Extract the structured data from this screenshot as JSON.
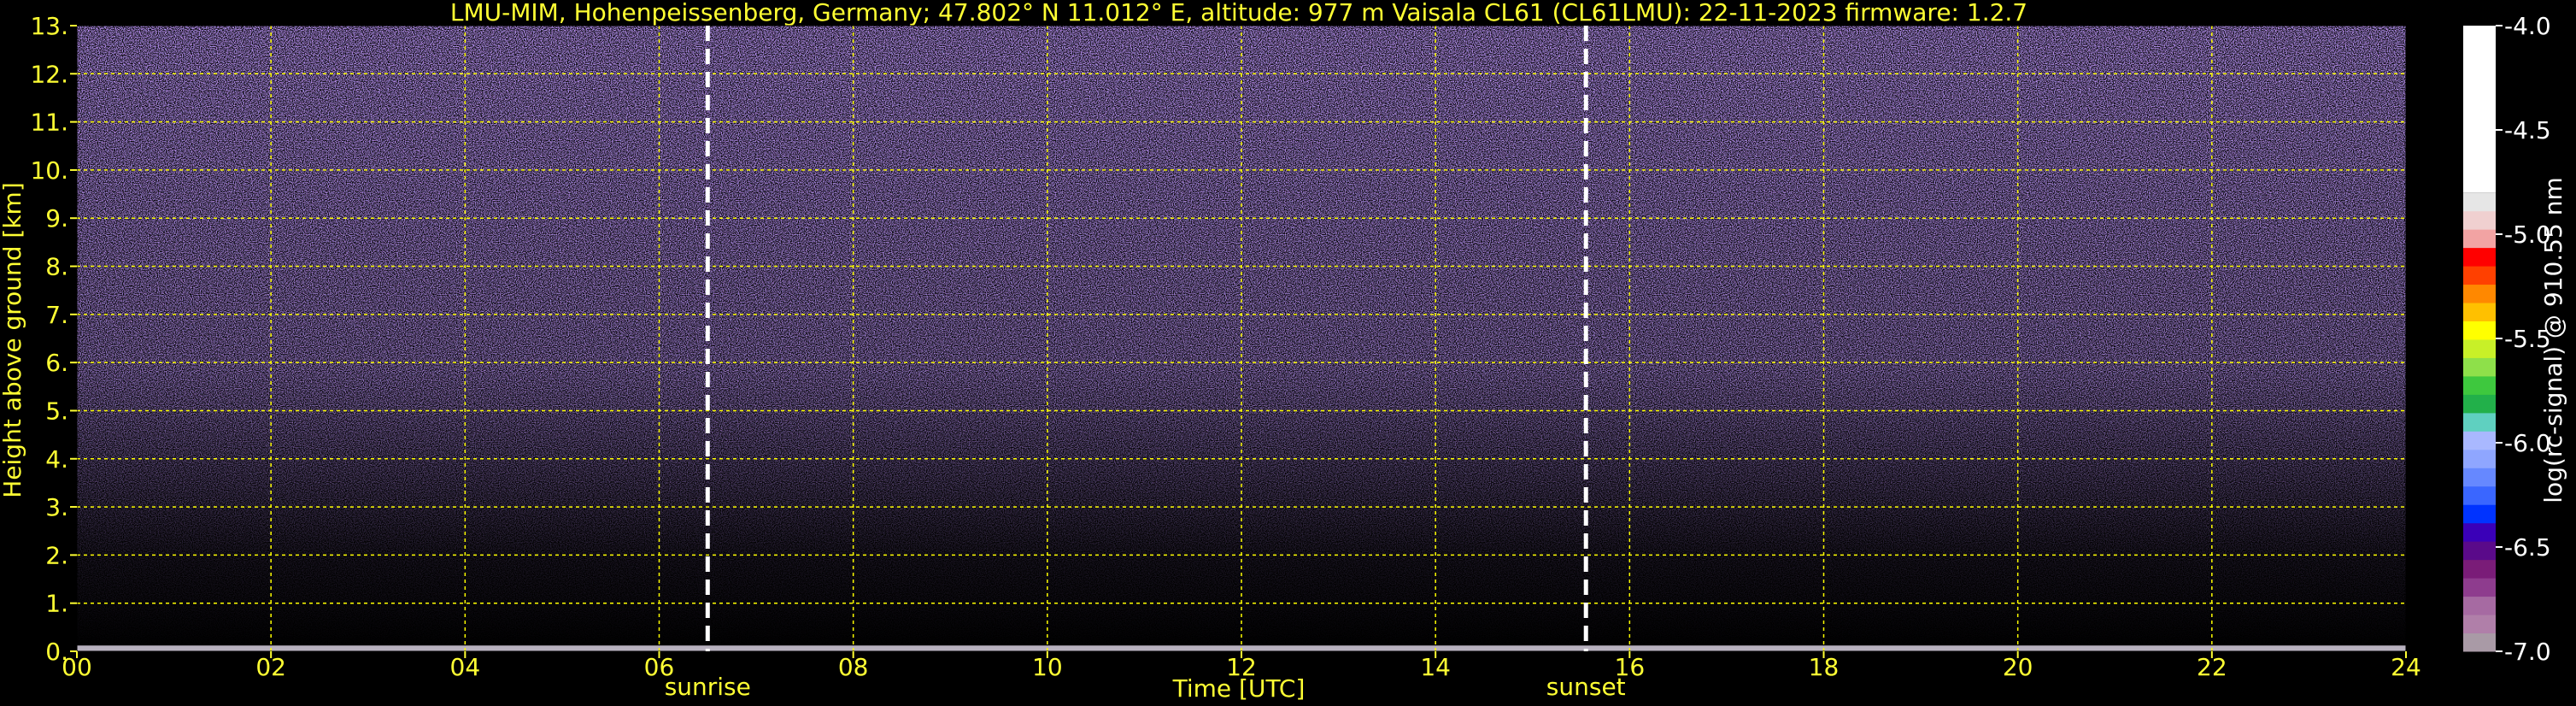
{
  "chart_data": {
    "type": "heatmap",
    "title": "LMU-MIM, Hohenpeissenberg, Germany; 47.802° N 11.012° E, altitude: 977 m    Vaisala CL61 (CL61LMU): 22-11-2023    firmware: 1.2.7",
    "xlabel": "Time [UTC]",
    "ylabel": "Height above ground [km]",
    "xlim": [
      0,
      24
    ],
    "ylim": [
      0,
      13
    ],
    "x_ticks": [
      "00",
      "02",
      "04",
      "06",
      "08",
      "10",
      "12",
      "14",
      "16",
      "18",
      "20",
      "22",
      "24"
    ],
    "x_tick_values": [
      0,
      2,
      4,
      6,
      8,
      10,
      12,
      14,
      16,
      18,
      20,
      22,
      24
    ],
    "y_ticks": [
      "0.",
      "1.",
      "2.",
      "3.",
      "4.",
      "5.",
      "6.",
      "7.",
      "8.",
      "9.",
      "10.",
      "11.",
      "12.",
      "13."
    ],
    "y_tick_values": [
      0,
      1,
      2,
      3,
      4,
      5,
      6,
      7,
      8,
      9,
      10,
      11,
      12,
      13
    ],
    "grid": true,
    "annotations": [
      {
        "label": "sunrise",
        "x": 6.5
      },
      {
        "label": "sunset",
        "x": 15.55
      }
    ],
    "colorbar": {
      "label": "log(rc-signal) @ 910.55 nm",
      "range": [
        -7.0,
        -4.0
      ],
      "ticks": [
        "-4.0",
        "-4.5",
        "-5.0",
        "-5.5",
        "-6.0",
        "-6.5",
        "-7.0"
      ],
      "tick_values": [
        -4.0,
        -4.5,
        -5.0,
        -5.5,
        -6.0,
        -6.5,
        -7.0
      ],
      "colors_bottom_to_top": [
        "#a99aa6",
        "#b07fa9",
        "#a66aa2",
        "#8e3c8e",
        "#7a1c78",
        "#5a0a8a",
        "#3a00b8",
        "#0033ff",
        "#3a66ff",
        "#6688ff",
        "#8fa6ff",
        "#a9b8ff",
        "#5fd0c0",
        "#22b04a",
        "#3ec83e",
        "#8ee04a",
        "#c8f028",
        "#ffff00",
        "#ffc000",
        "#ff8800",
        "#ff4000",
        "#ff0000",
        "#f2a3a3",
        "#f0d0d0",
        "#e6e6e6",
        "#ffffff"
      ]
    },
    "grid_color": "#ffff00",
    "annotation_line_color": "#ffffff"
  }
}
